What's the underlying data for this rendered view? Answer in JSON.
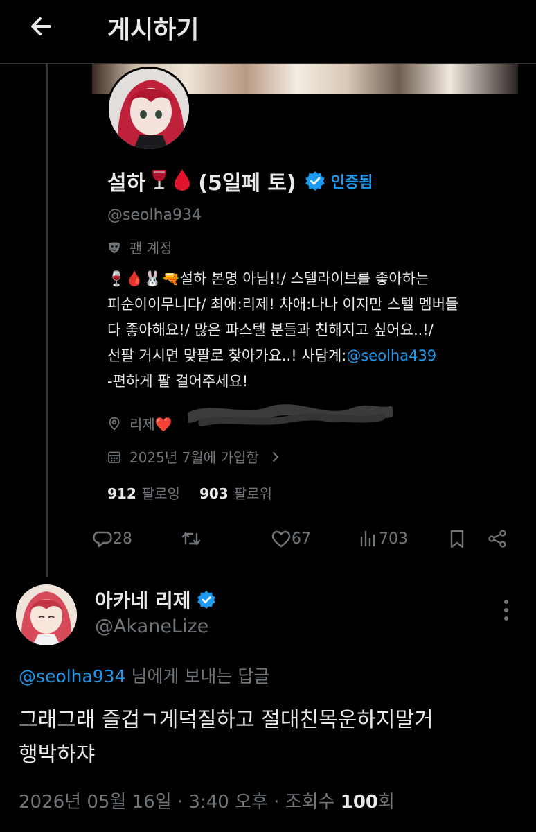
{
  "header": {
    "title": "게시하기",
    "back_icon": "arrow-left-icon"
  },
  "colors": {
    "background": "#000000",
    "text": "#e7e9ea",
    "muted": "#71767b",
    "link": "#1d9bf0",
    "divider": "#2f3336"
  },
  "quoted_profile": {
    "name": "설하",
    "name_emojis": [
      "🍷",
      "🩸"
    ],
    "name_suffix": "(5일페 토)",
    "verified_label": "인증됨",
    "handle": "@seolha934",
    "fan_label": "팬 계정",
    "bio_lines": [
      "🍷🩸🐰🔫설하 본명 아님!!/ 스텔라이브를 좋아하는",
      "피순이이무니다/ 최애:리제! 차애:나나 이지만 스텔 멤버들",
      "다 좋아해요!/ 많은 파스텔 분들과 친해지고 싶어요..!/",
      "선팔 거시면 맞팔로 찾아가요..!  사담계:",
      "-편하게 팔 걸어주세요!"
    ],
    "bio_link": "@seolha439",
    "location": "리제❤️",
    "joined": "2025년 7월에 가입함",
    "following_count": "912",
    "following_label": "팔로잉",
    "followers_count": "903",
    "followers_label": "팔로워"
  },
  "actions": {
    "replies": "28",
    "likes": "67",
    "views": "703"
  },
  "reply": {
    "name": "아카네 리제",
    "handle": "@AkaneLize",
    "reply_to_handle": "@seolha934",
    "reply_to_suffix": " 님에게 보내는 답글",
    "body_lines": [
      "그래그래 즐겁ㄱ게덕질하고 절대친목운하지말거",
      "행박하쟈"
    ],
    "timestamp_prefix": "2026년 05월 16일 · 3:40 오후 · 조회수 ",
    "views_count": "100",
    "views_suffix": "회"
  }
}
